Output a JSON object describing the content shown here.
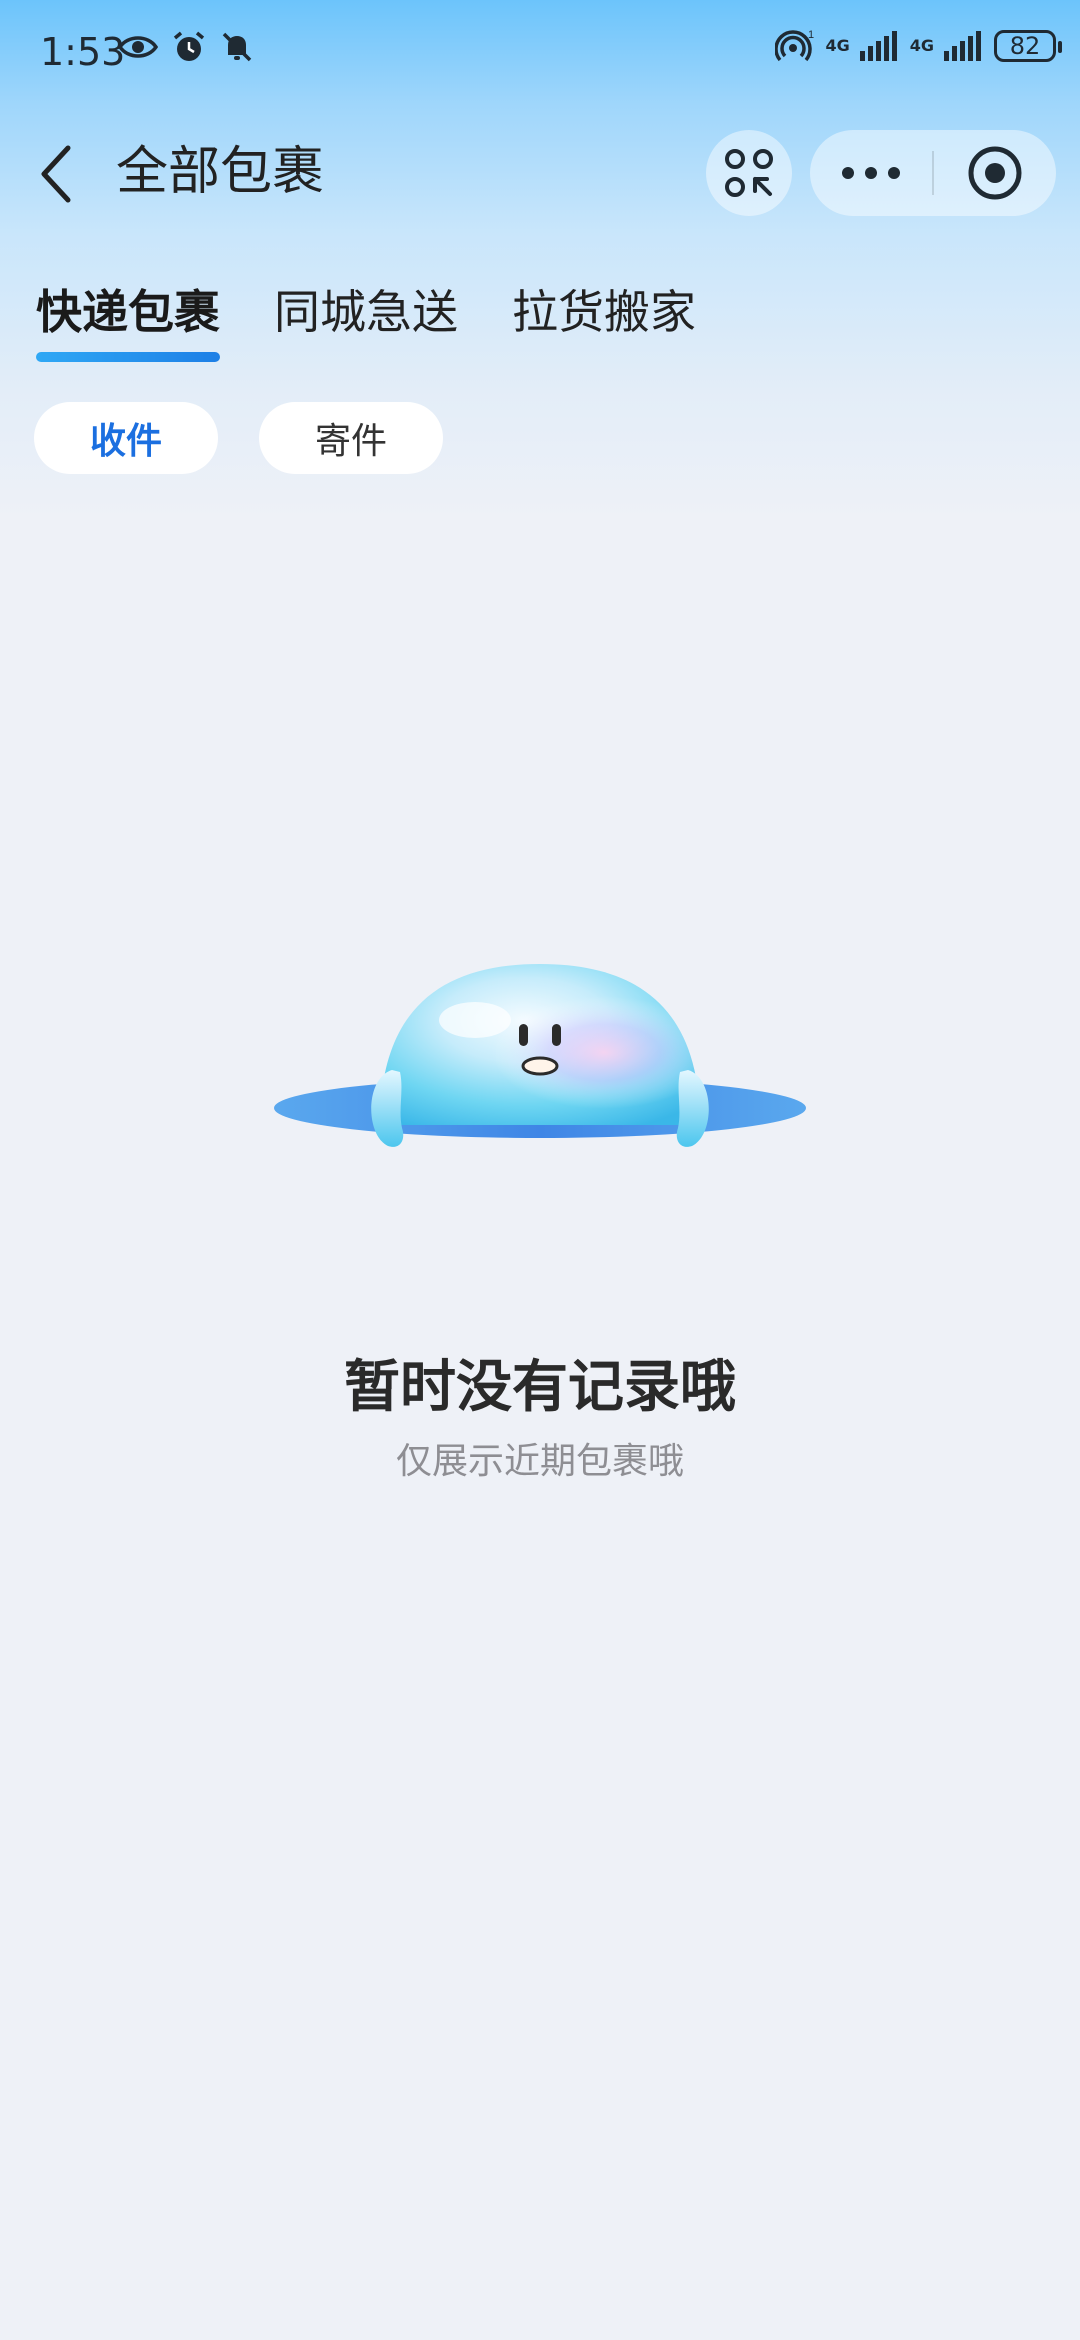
{
  "status_bar": {
    "time": "1:53",
    "network_label_1": "4G",
    "network_label_2": "4G",
    "battery": "82",
    "icons": [
      "eye-icon",
      "alarm-icon",
      "bell-off-icon",
      "hotspot-icon",
      "signal-icon",
      "battery-icon"
    ]
  },
  "header": {
    "title": "全部包裹",
    "icons": [
      "back-icon",
      "scan-icon",
      "more-icon",
      "target-icon"
    ]
  },
  "tabs": [
    {
      "label": "快递包裹",
      "active": true
    },
    {
      "label": "同城急送",
      "active": false
    },
    {
      "label": "拉货搬家",
      "active": false
    }
  ],
  "segments": {
    "receive": "收件",
    "send": "寄件",
    "active": "receive"
  },
  "empty_state": {
    "title": "暂时没有记录哦",
    "subtitle": "仅展示近期包裹哦",
    "illustration": "bubble-mascot-illustration"
  },
  "colors": {
    "accent": "#1b6fe0",
    "header_gradient_top": "#6cc4fb",
    "background": "#eef1f7"
  }
}
